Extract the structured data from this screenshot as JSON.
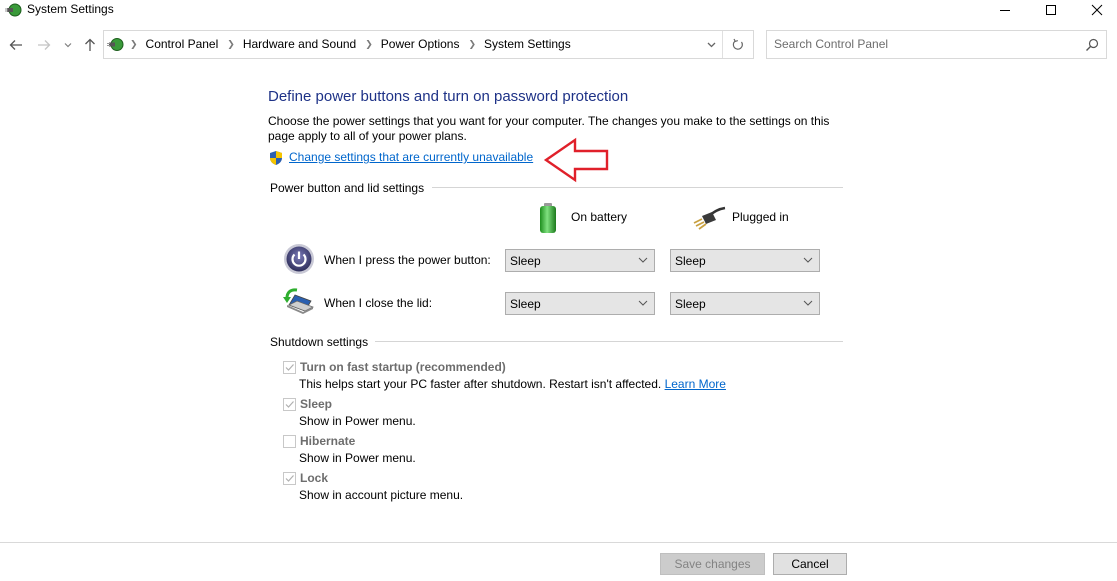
{
  "window": {
    "title": "System Settings",
    "controls": {
      "minimize": "minimize",
      "maximize": "maximize",
      "close": "close"
    }
  },
  "nav": {
    "back_icon": "arrow-left",
    "forward_icon": "arrow-right",
    "recent_icon": "chevron-down",
    "up_icon": "arrow-up",
    "breadcrumbs": [
      "Control Panel",
      "Hardware and Sound",
      "Power Options",
      "System Settings"
    ],
    "refresh_icon": "refresh"
  },
  "search": {
    "placeholder": "Search Control Panel",
    "value": ""
  },
  "main": {
    "title": "Define power buttons and turn on password protection",
    "description": "Choose the power settings that you want for your computer. The changes you make to the settings on this page apply to all of your power plans.",
    "change_link": "Change settings that are currently unavailable",
    "annotation": "red-arrow-pointing-left",
    "power_section": {
      "header": "Power button and lid settings",
      "columns": [
        "On battery",
        "Plugged in"
      ],
      "rows": [
        {
          "label": "When I press the power button:",
          "on_battery": "Sleep",
          "plugged_in": "Sleep"
        },
        {
          "label": "When I close the lid:",
          "on_battery": "Sleep",
          "plugged_in": "Sleep"
        }
      ]
    },
    "shutdown_section": {
      "header": "Shutdown settings",
      "options": [
        {
          "label": "Turn on fast startup (recommended)",
          "checked": true,
          "disabled": true,
          "description": "This helps start your PC faster after shutdown. Restart isn't affected.",
          "link": "Learn More"
        },
        {
          "label": "Sleep",
          "checked": true,
          "disabled": true,
          "description": "Show in Power menu."
        },
        {
          "label": "Hibernate",
          "checked": false,
          "disabled": true,
          "description": "Show in Power menu."
        },
        {
          "label": "Lock",
          "checked": true,
          "disabled": true,
          "description": "Show in account picture menu."
        }
      ]
    }
  },
  "footer": {
    "save_label": "Save changes",
    "cancel_label": "Cancel",
    "save_enabled": false
  },
  "colors": {
    "title_blue": "#1e3287",
    "link_blue": "#0066cc",
    "annotation_red": "#e0202a"
  }
}
